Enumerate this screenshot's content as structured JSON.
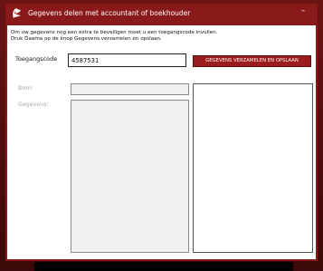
{
  "window": {
    "title": "Gegevens delen met accountant of boekhouder",
    "minimize_label": "–"
  },
  "intro": {
    "line1": "Om uw gegevens nog een extra te beveiligen moet u een toegangscode invullen.",
    "line2": "Druk Daama op de knop Gegevens verzamelen en opslaan."
  },
  "form": {
    "token_label": "Toegangscode",
    "token_value": "4587531",
    "collect_button": "GEGEVENS VERZAMELEN EN OPSLAAN",
    "source_label": "Bron:",
    "data_label": "Gegevens:"
  },
  "colors": {
    "accent": "#9b1c1c",
    "titlebar": "#8a1a1a"
  }
}
